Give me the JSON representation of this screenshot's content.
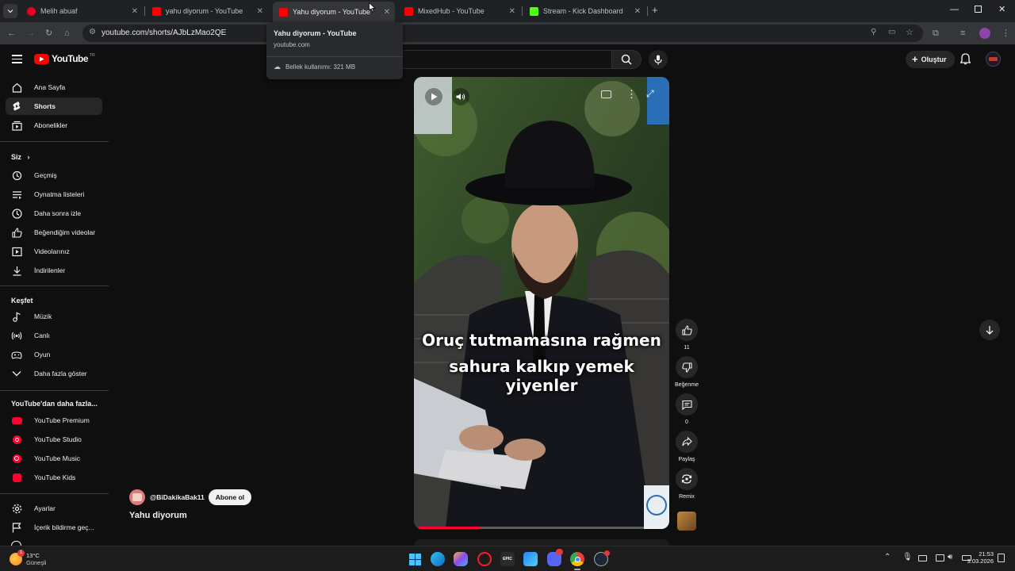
{
  "browser": {
    "tabs": [
      {
        "title": "Melih abuaf",
        "icon": "pinterest-icon",
        "color": "#e60023"
      },
      {
        "title": "yahu diyorum - YouTube",
        "icon": "youtube-icon",
        "color": "#ff0000"
      },
      {
        "title": "Yahu diyorum - YouTube",
        "icon": "youtube-icon",
        "color": "#ff0000",
        "active": true
      },
      {
        "title": "MixedHub - YouTube",
        "icon": "youtube-icon",
        "color": "#ff0000"
      },
      {
        "title": "Stream - Kick Dashboard",
        "icon": "kick-icon",
        "color": "#53fc18"
      }
    ],
    "url": "youtube.com/shorts/AJbLzMao2QE",
    "tooltip": {
      "title": "Yahu diyorum - YouTube",
      "domain": "youtube.com",
      "memory": "Bellek kullanımı: 321 MB"
    }
  },
  "youtube": {
    "logo_text": "YouTube",
    "logo_region": "TR",
    "create_label": "Oluştur"
  },
  "sidebar": {
    "main": [
      {
        "label": "Ana Sayfa",
        "icon": "home-icon"
      },
      {
        "label": "Shorts",
        "icon": "shorts-icon",
        "active": true
      },
      {
        "label": "Abonelikler",
        "icon": "subscriptions-icon"
      }
    ],
    "you_heading": "Siz",
    "you": [
      {
        "label": "Geçmiş",
        "icon": "history-icon"
      },
      {
        "label": "Oynatma listeleri",
        "icon": "playlists-icon"
      },
      {
        "label": "Daha sonra izle",
        "icon": "watch-later-icon"
      },
      {
        "label": "Beğendiğim videolar",
        "icon": "liked-icon"
      },
      {
        "label": "Videolarınız",
        "icon": "your-videos-icon"
      },
      {
        "label": "İndirilenler",
        "icon": "downloads-icon"
      }
    ],
    "explore_heading": "Keşfet",
    "explore": [
      {
        "label": "Müzik",
        "icon": "music-icon"
      },
      {
        "label": "Canlı",
        "icon": "live-icon"
      },
      {
        "label": "Oyun",
        "icon": "gaming-icon"
      },
      {
        "label": "Daha fazla göster",
        "icon": "chevron-down-icon"
      }
    ],
    "more_heading": "YouTube'dan daha fazla...",
    "more": [
      {
        "label": "YouTube Premium",
        "icon": "yt-premium-icon"
      },
      {
        "label": "YouTube Studio",
        "icon": "yt-studio-icon"
      },
      {
        "label": "YouTube Music",
        "icon": "yt-music-icon"
      },
      {
        "label": "YouTube Kids",
        "icon": "yt-kids-icon"
      }
    ],
    "footer": [
      {
        "label": "Ayarlar",
        "icon": "settings-icon"
      },
      {
        "label": "İçerik bildirme geç...",
        "icon": "flag-icon"
      }
    ]
  },
  "short": {
    "caption_line1": "Oruç tutmamasına rağmen",
    "caption_line2": "sahura kalkıp yemek yiyenler",
    "channel": "@BiDakikaBak11",
    "subscribe_label": "Abone ol",
    "title": "Yahu diyorum",
    "likes": "11",
    "dislike_label": "Beğenme",
    "comments": "0",
    "share_label": "Paylaş",
    "remix_label": "Remix",
    "progress": 0.25
  },
  "taskbar": {
    "weather_temp": "13°C",
    "weather_desc": "Güneşli",
    "weather_badge": "1",
    "time": "21:53",
    "date": "3.03.2026"
  }
}
